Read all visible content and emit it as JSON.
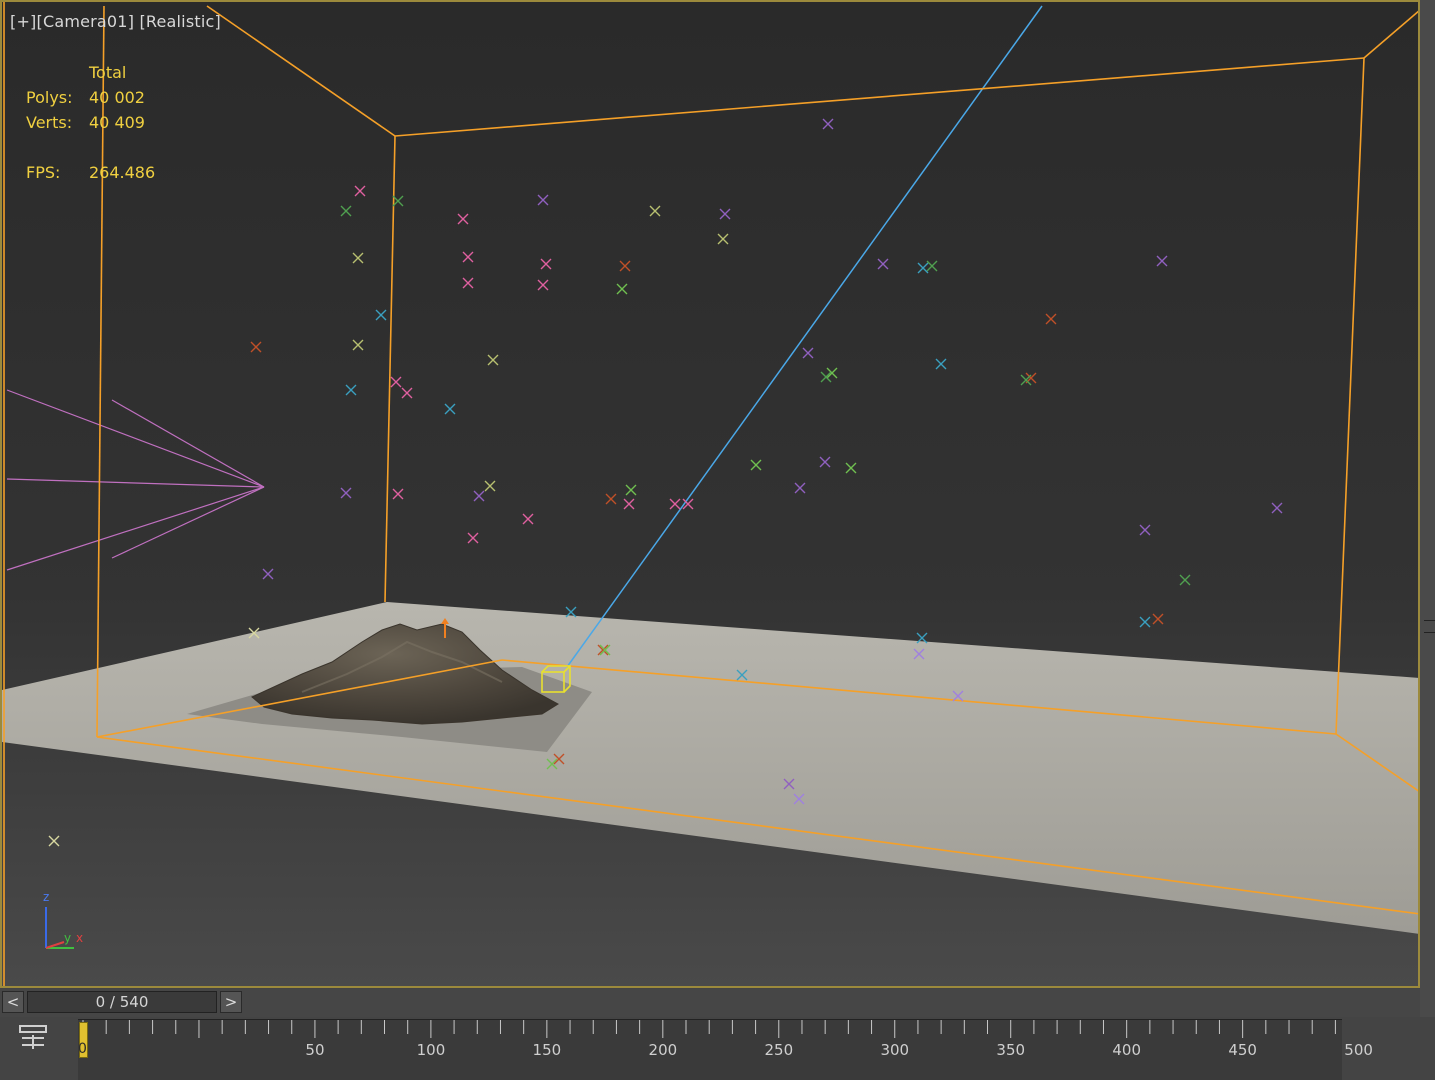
{
  "viewport": {
    "label_plus": "[+]",
    "label_camera": "[Camera01]",
    "label_shading": "[Realistic]",
    "stats": {
      "header": "Total",
      "polys_label": "Polys:",
      "polys_value": "40 002",
      "verts_label": "Verts:",
      "verts_value": "40 409",
      "fps_label": "FPS:",
      "fps_value": "264.486"
    },
    "axis": {
      "z": "z",
      "y": "y",
      "x": "x"
    },
    "colors": {
      "bounding_box": "#f5a028",
      "camera_ray": "#4aa8e8",
      "light_cone": "#c070c0",
      "selection": "#e8e030",
      "ground": "#a8a69e",
      "sky": "#2f2f2f"
    }
  },
  "timebar": {
    "prev_label": "<",
    "next_label": ">",
    "frame_display": "0 / 540"
  },
  "trackbar": {
    "current_frame": "0",
    "labels": [
      "50",
      "100",
      "150",
      "200",
      "250",
      "300",
      "350",
      "400",
      "450",
      "500"
    ]
  }
}
